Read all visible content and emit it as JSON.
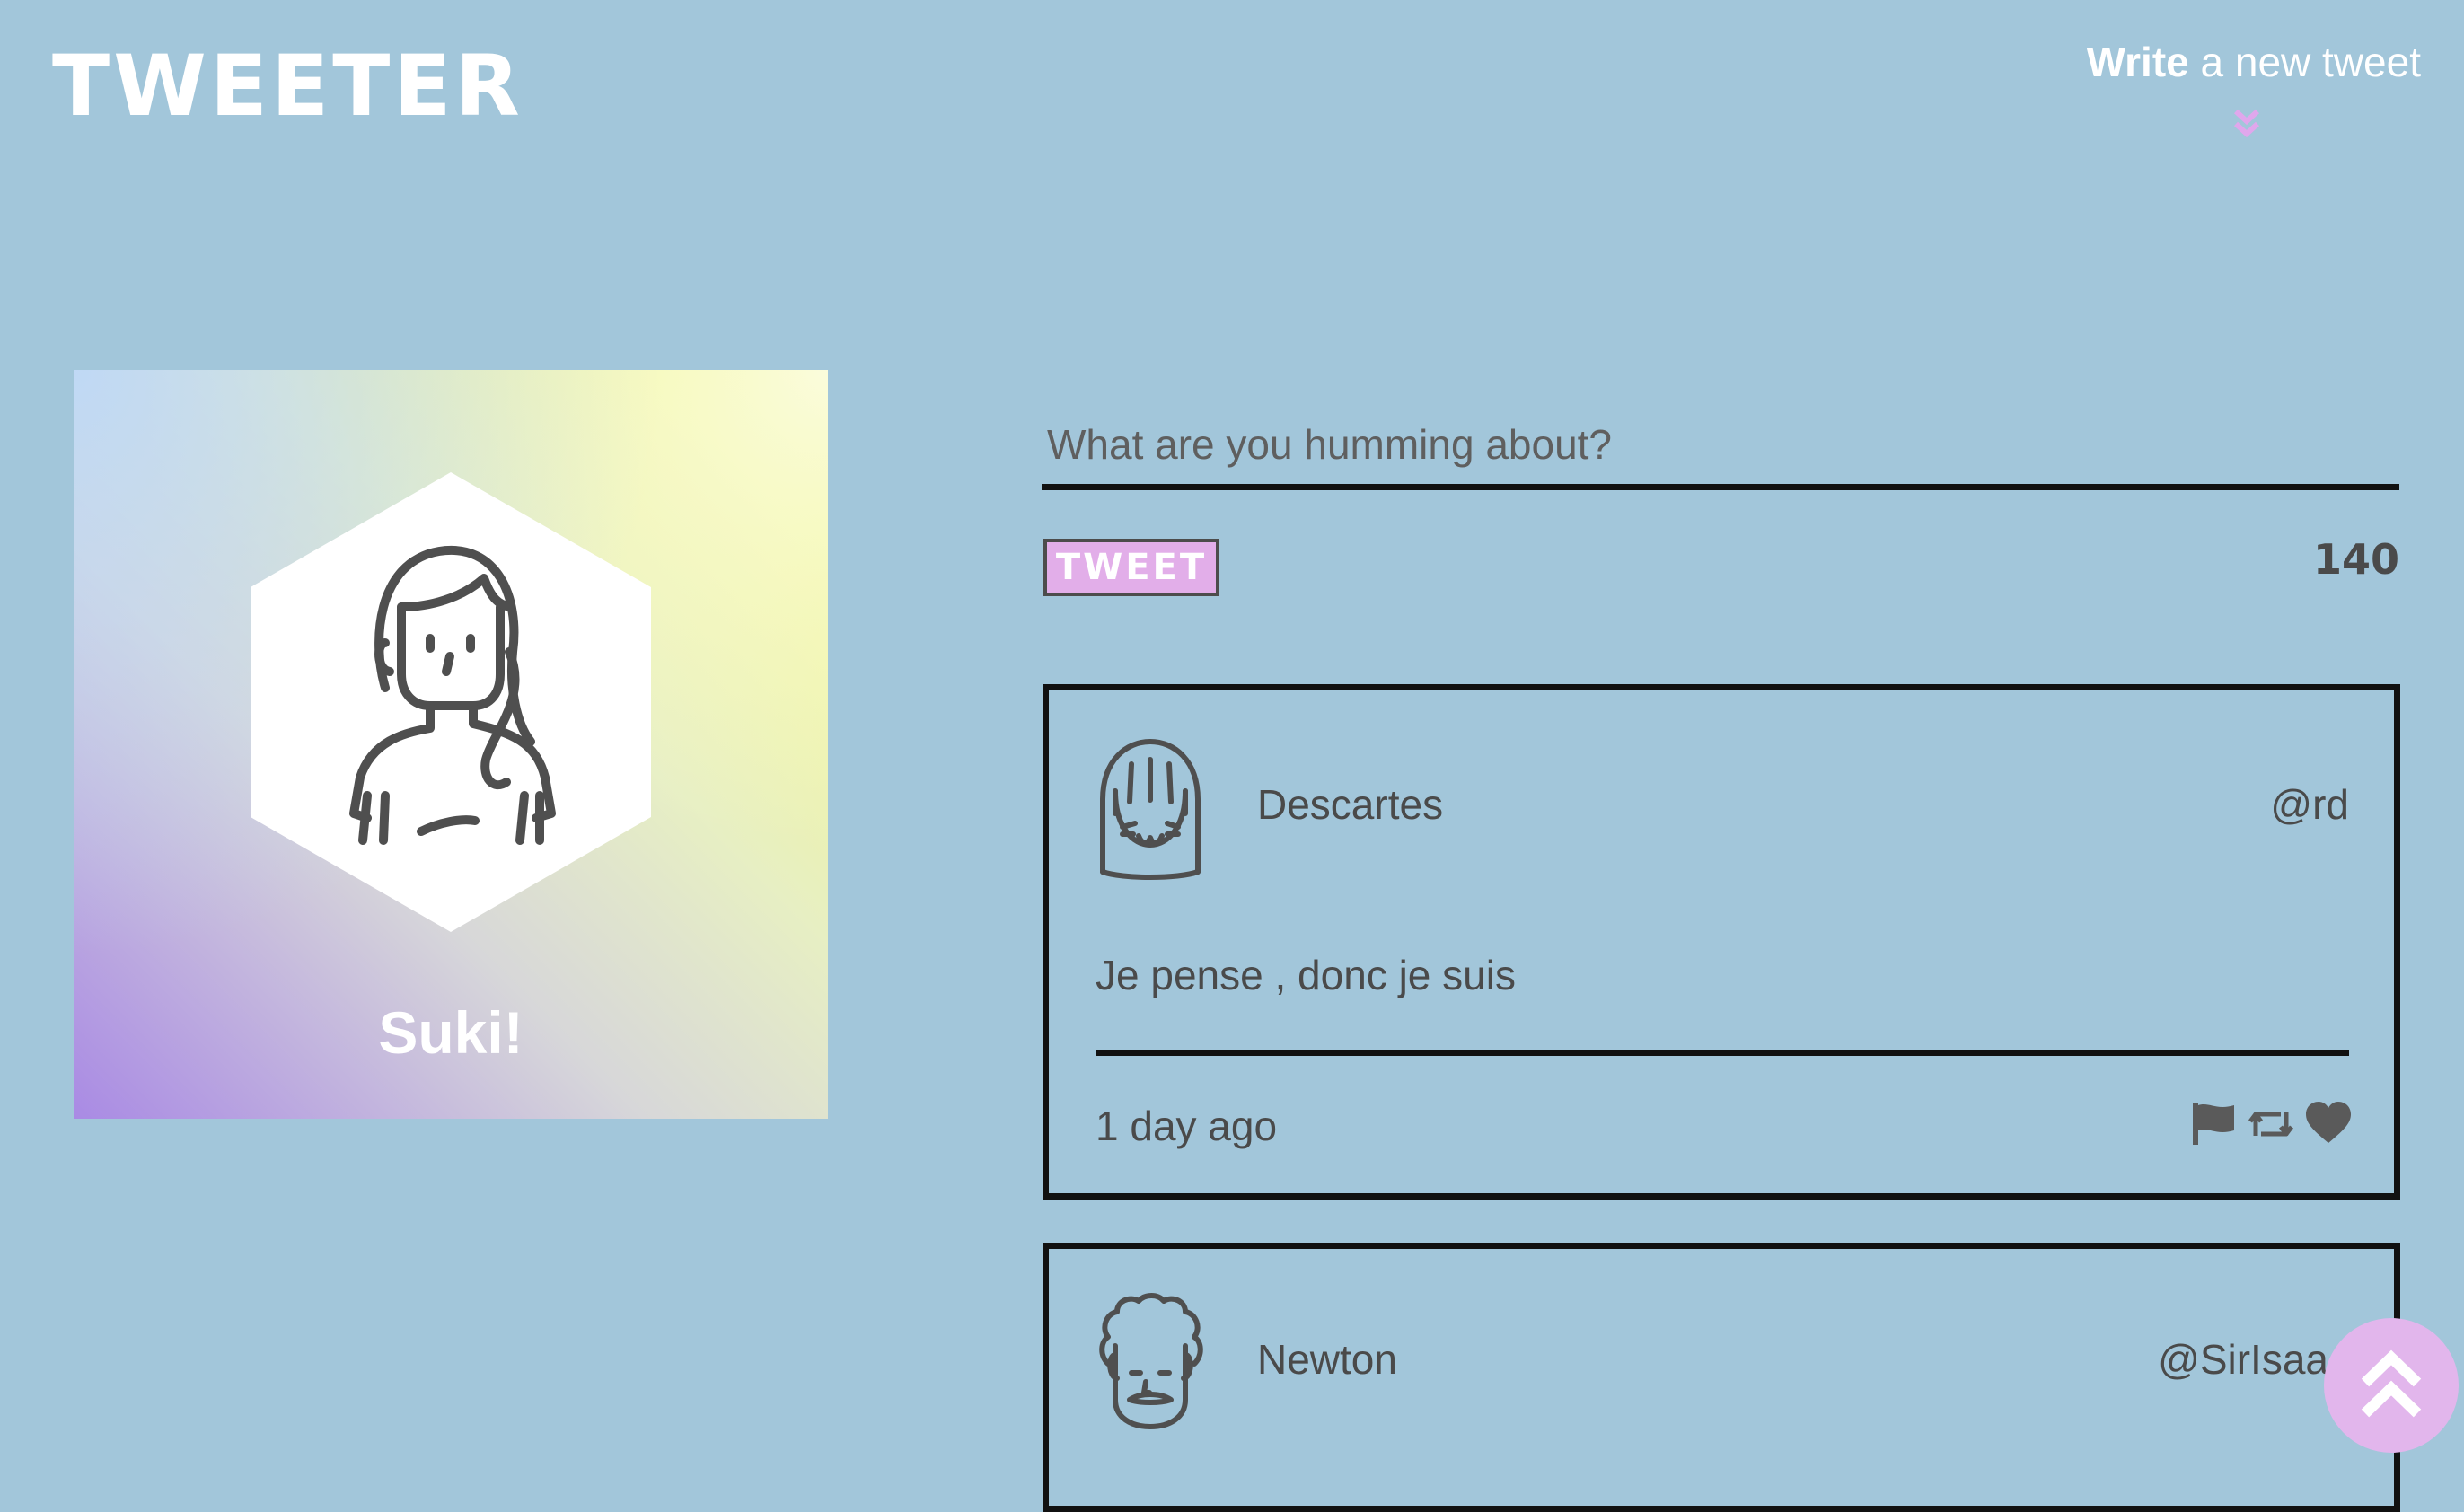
{
  "header": {
    "logo": "TWEETER",
    "write_strong": "Write",
    "write_rest": " a new tweet"
  },
  "profile": {
    "name": "Suki!"
  },
  "composer": {
    "placeholder": "What are you humming about?",
    "button_label": "TWEET",
    "counter": "140"
  },
  "tweets": [
    {
      "name": "Descartes",
      "handle": "@rd",
      "text": "Je pense , donc je suis",
      "time": "1 day ago"
    },
    {
      "name": "Newton",
      "handle": "@SirIsaac"
    }
  ],
  "icons": {
    "flag": "flag-icon",
    "retweet": "retweet-icon",
    "like": "heart-icon",
    "scroll_top": "double-chevron-up-icon"
  },
  "colors": {
    "background": "#a2c6da",
    "accent": "#e2aee9",
    "text": "#4a4a4a"
  }
}
